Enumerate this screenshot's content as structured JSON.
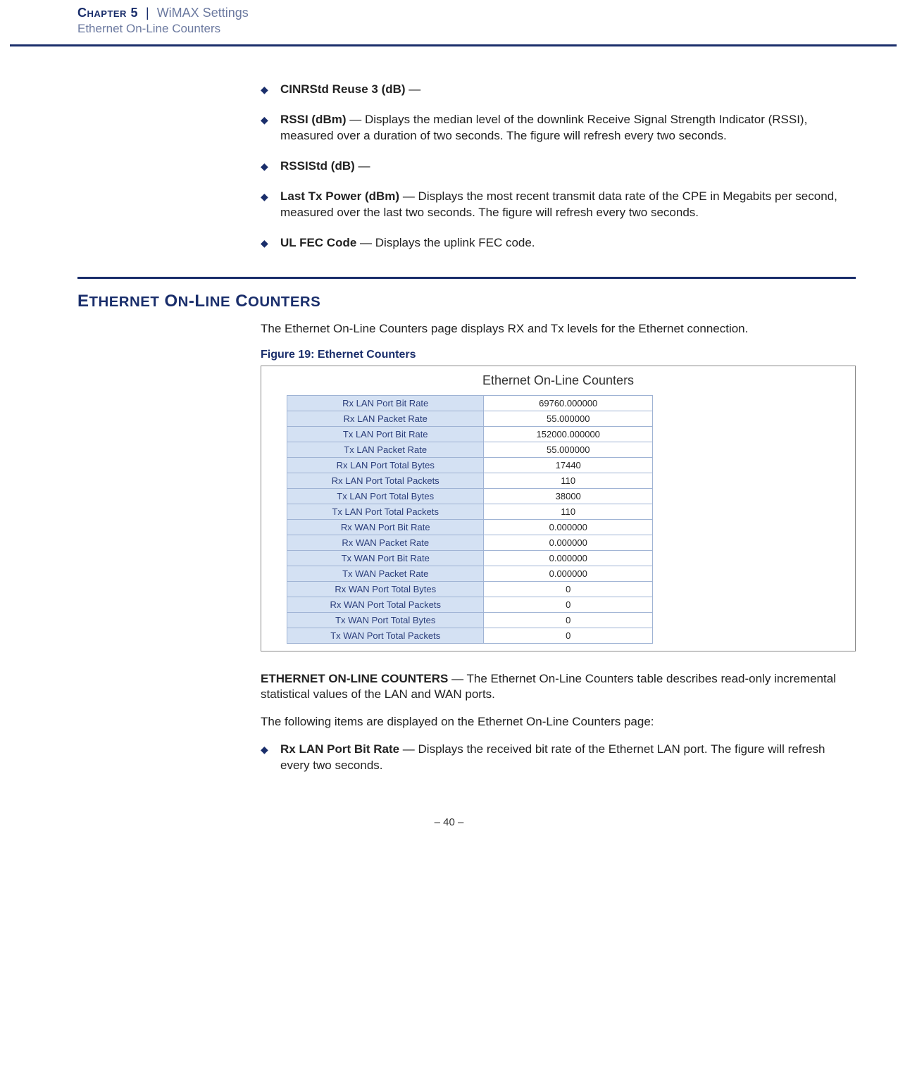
{
  "header": {
    "chapter_label": "Chapter 5",
    "separator": "|",
    "chapter_title": "WiMAX Settings",
    "subtitle": "Ethernet On-Line Counters"
  },
  "top_bullets": [
    {
      "term": "CINRStd Reuse 3 (dB)",
      "desc": " — "
    },
    {
      "term": "RSSI (dBm)",
      "desc": " — Displays the median level of the downlink Receive Signal Strength Indicator (RSSI), measured over a duration of two seconds. The figure will refresh every two seconds."
    },
    {
      "term": "RSSIStd (dB)",
      "desc": " — "
    },
    {
      "term": "Last Tx Power (dBm)",
      "desc": " — Displays the most recent transmit data rate of the CPE in Megabits per second, measured over the last two seconds. The figure will refresh every two seconds."
    },
    {
      "term": "UL FEC Code",
      "desc": " — Displays the uplink FEC code."
    }
  ],
  "section": {
    "title": "Ethernet On-Line Counters",
    "intro": "The Ethernet On-Line Counters page displays RX and Tx levels for the Ethernet connection.",
    "figure_caption": "Figure 19:  Ethernet Counters",
    "figure_title": "Ethernet On-Line Counters",
    "counters": [
      {
        "label": "Rx LAN Port Bit Rate",
        "value": "69760.000000"
      },
      {
        "label": "Rx LAN Packet Rate",
        "value": "55.000000"
      },
      {
        "label": "Tx LAN Port Bit Rate",
        "value": "152000.000000"
      },
      {
        "label": "Tx LAN Packet Rate",
        "value": "55.000000"
      },
      {
        "label": "Rx LAN Port Total Bytes",
        "value": "17440"
      },
      {
        "label": "Rx LAN Port Total Packets",
        "value": "110"
      },
      {
        "label": "Tx LAN Port Total Bytes",
        "value": "38000"
      },
      {
        "label": "Tx LAN Port Total Packets",
        "value": "110"
      },
      {
        "label": "Rx WAN Port Bit Rate",
        "value": "0.000000"
      },
      {
        "label": "Rx WAN Packet Rate",
        "value": "0.000000"
      },
      {
        "label": "Tx WAN Port Bit Rate",
        "value": "0.000000"
      },
      {
        "label": "Tx WAN Packet Rate",
        "value": "0.000000"
      },
      {
        "label": "Rx WAN Port Total Bytes",
        "value": "0"
      },
      {
        "label": "Rx WAN Port Total Packets",
        "value": "0"
      },
      {
        "label": "Tx WAN Port Total Bytes",
        "value": "0"
      },
      {
        "label": "Tx WAN Port Total Packets",
        "value": "0"
      }
    ],
    "para_lead_term": "ETHERNET ON-LINE COUNTERS",
    "para_lead_desc": " — The Ethernet On-Line Counters table describes read-only incremental statistical values of the LAN and WAN ports.",
    "para_follow": "The following items are displayed on the Ethernet On-Line Counters page:"
  },
  "bottom_bullets": [
    {
      "term": "Rx LAN Port Bit Rate",
      "desc": " — Displays the received bit rate of the Ethernet LAN port. The figure will refresh every two seconds."
    }
  ],
  "footer": {
    "page_number": "–  40  –"
  },
  "chart_data": {
    "type": "table",
    "title": "Ethernet On-Line Counters",
    "columns": [
      "Metric",
      "Value"
    ],
    "rows": [
      [
        "Rx LAN Port Bit Rate",
        69760.0
      ],
      [
        "Rx LAN Packet Rate",
        55.0
      ],
      [
        "Tx LAN Port Bit Rate",
        152000.0
      ],
      [
        "Tx LAN Packet Rate",
        55.0
      ],
      [
        "Rx LAN Port Total Bytes",
        17440
      ],
      [
        "Rx LAN Port Total Packets",
        110
      ],
      [
        "Tx LAN Port Total Bytes",
        38000
      ],
      [
        "Tx LAN Port Total Packets",
        110
      ],
      [
        "Rx WAN Port Bit Rate",
        0.0
      ],
      [
        "Rx WAN Packet Rate",
        0.0
      ],
      [
        "Tx WAN Port Bit Rate",
        0.0
      ],
      [
        "Tx WAN Packet Rate",
        0.0
      ],
      [
        "Rx WAN Port Total Bytes",
        0
      ],
      [
        "Rx WAN Port Total Packets",
        0
      ],
      [
        "Tx WAN Port Total Bytes",
        0
      ],
      [
        "Tx WAN Port Total Packets",
        0
      ]
    ]
  }
}
